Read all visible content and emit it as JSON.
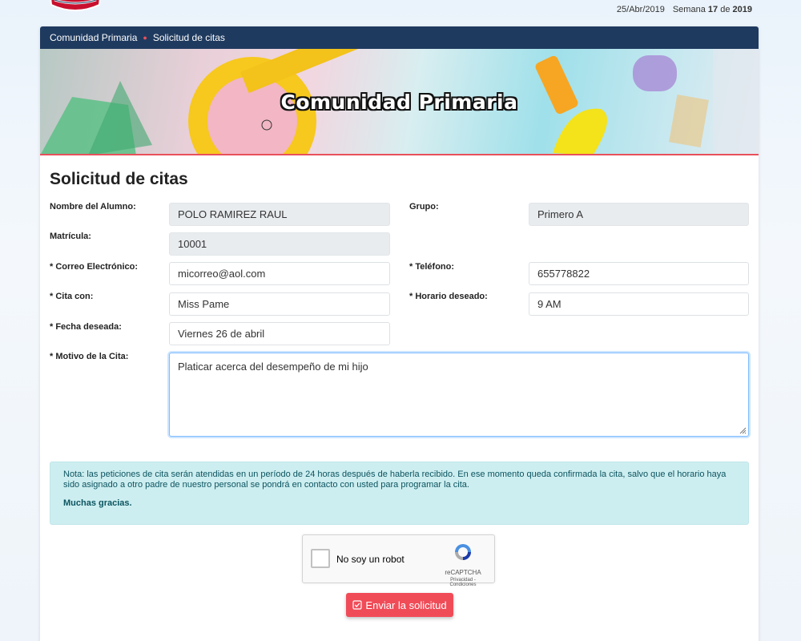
{
  "header": {
    "date": "25/Abr/2019",
    "week_label": "Semana",
    "week_number": "17",
    "week_of": "de",
    "year": "2019"
  },
  "breadcrumb": {
    "items": [
      "Comunidad Primaria",
      "Solicitud de citas"
    ]
  },
  "banner": {
    "title": "Comunidad Primaria"
  },
  "page": {
    "title": "Solicitud de citas"
  },
  "form": {
    "student_name": {
      "label": "Nombre del Alumno:",
      "value": "POLO RAMIREZ RAUL"
    },
    "group": {
      "label": "Grupo:",
      "value": "Primero A"
    },
    "enrollment": {
      "label": "Matrícula:",
      "value": "10001"
    },
    "email": {
      "label": "* Correo Electrónico:",
      "value": "micorreo@aol.com"
    },
    "phone": {
      "label": "* Teléfono:",
      "value": "655778822"
    },
    "meeting_with": {
      "label": "* Cita con:",
      "value": "Miss Pame"
    },
    "preferred_time": {
      "label": "* Horario deseado:",
      "value": "9 AM"
    },
    "preferred_date": {
      "label": "* Fecha deseada:",
      "value": "Viernes 26 de abril"
    },
    "reason": {
      "label": "* Motivo de la Cita:",
      "value": "Platicar acerca del desempeño de mi hijo"
    }
  },
  "note": {
    "text": "Nota: las peticiones de cita serán atendidas en un período de 24 horas después de haberla recibido. En ese momento queda confirmada la cita, salvo que el horario haya sido asignado a otro padre de nuestro personal se pondrá en contacto con usted para programar la cita.",
    "thanks": "Muchas gracias."
  },
  "captcha": {
    "label": "No soy un robot",
    "brand": "reCAPTCHA",
    "links": "Privacidad - Condiciones"
  },
  "submit": {
    "label": "Enviar la solicitud"
  },
  "colors": {
    "navy": "#1f3a5f",
    "accent_red": "#f04c58",
    "note_bg": "#cdeef0",
    "note_text": "#0c5460"
  }
}
